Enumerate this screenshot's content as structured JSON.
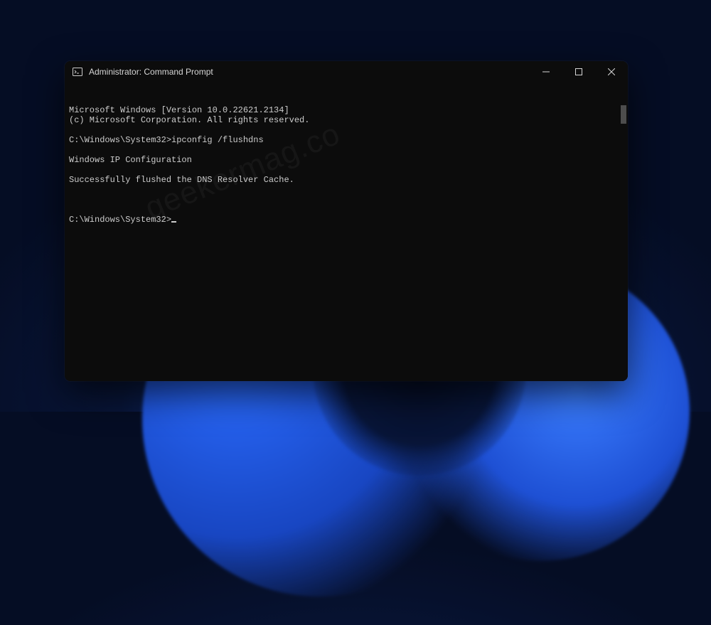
{
  "window": {
    "title": "Administrator: Command Prompt"
  },
  "terminal": {
    "lines": [
      "Microsoft Windows [Version 10.0.22621.2134]",
      "(c) Microsoft Corporation. All rights reserved.",
      "",
      "C:\\Windows\\System32>ipconfig /flushdns",
      "",
      "Windows IP Configuration",
      "",
      "Successfully flushed the DNS Resolver Cache.",
      ""
    ],
    "prompt": "C:\\Windows\\System32>"
  },
  "watermark": "geekermag.co"
}
